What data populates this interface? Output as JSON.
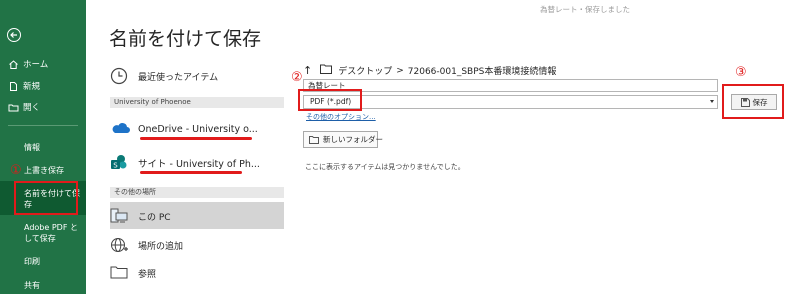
{
  "title_bar": "為替レート・保存しました",
  "heading": "名前を付けて保存",
  "nav": {
    "home": "ホーム",
    "new": "新規",
    "open": "開く",
    "info": "情報",
    "save": "上書き保存",
    "save_as": "名前を付けて保存",
    "save_adobe_pdf": "Adobe PDF として保存",
    "print": "印刷",
    "share": "共有"
  },
  "locations": {
    "recent": "最近使ったアイテム",
    "org_section": "University of Phoenoe",
    "onedrive": "OneDrive - University o...",
    "sites": "サイト - University of Ph...",
    "other_section": "その他の場所",
    "this_pc": "この PC",
    "add_place": "場所の追加",
    "browse": "参照"
  },
  "save_pane": {
    "path_root": "デスクトップ",
    "path_sep": ">",
    "path_folder": "72066-001_SBPS本番環境接続情報",
    "filename": "為替レート",
    "filetype": "PDF (*.pdf)",
    "more_options": "その他のオプション...",
    "save_button": "保存",
    "new_folder_button": "新しいフォルダー",
    "empty_message": "ここに表示するアイテムは見つかりませんでした。"
  },
  "annotations": {
    "marker1": "①",
    "marker2": "②",
    "marker3": "③"
  },
  "colors": {
    "nav_green": "#217346",
    "nav_selected": "#0f5a31",
    "annotation_red": "#e11b1b"
  }
}
